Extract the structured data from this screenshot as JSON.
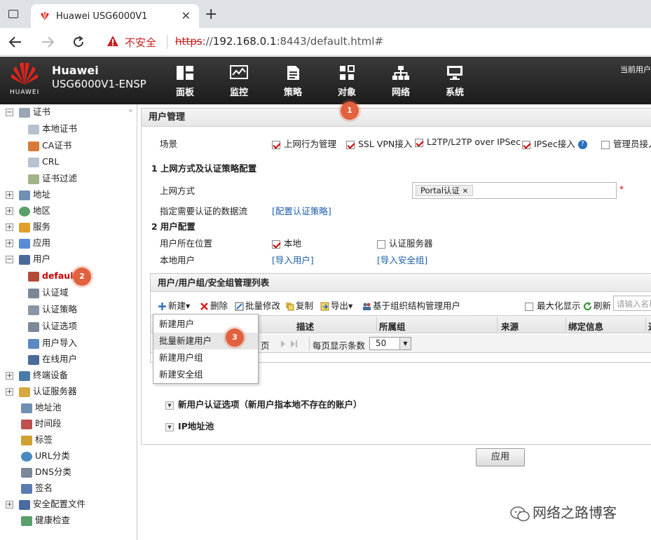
{
  "browser": {
    "tab_title": "Huawei USG6000V1",
    "tab_close": "✕",
    "new_tab": "+",
    "security_label": "不安全",
    "url_scheme": "https",
    "url_host": "192.168.0.1",
    "url_rest": ":8443/default.html#"
  },
  "header": {
    "logo_text": "HUAWEI",
    "brand_name": "Huawei",
    "product_name": "USG6000V1-ENSP",
    "current_user_label": "当前用户",
    "nav": [
      {
        "label": "面板",
        "icon": "dashboard-icon"
      },
      {
        "label": "监控",
        "icon": "monitor-icon"
      },
      {
        "label": "策略",
        "icon": "policy-icon"
      },
      {
        "label": "对象",
        "icon": "object-icon"
      },
      {
        "label": "网络",
        "icon": "network-icon"
      },
      {
        "label": "系统",
        "icon": "system-icon"
      }
    ]
  },
  "sidebar": {
    "collapse": "«",
    "items": [
      {
        "label": "证书",
        "expander": "−"
      },
      {
        "label": "本地证书"
      },
      {
        "label": "CA证书"
      },
      {
        "label": "CRL"
      },
      {
        "label": "证书过滤"
      },
      {
        "label": "地址",
        "expander": "+"
      },
      {
        "label": "地区",
        "expander": "+"
      },
      {
        "label": "服务",
        "expander": "+"
      },
      {
        "label": "应用",
        "expander": "+"
      },
      {
        "label": "用户",
        "expander": "−"
      },
      {
        "label": "default"
      },
      {
        "label": "认证域"
      },
      {
        "label": "认证策略"
      },
      {
        "label": "认证选项"
      },
      {
        "label": "用户导入"
      },
      {
        "label": "在线用户"
      },
      {
        "label": "终端设备",
        "expander": "+"
      },
      {
        "label": "认证服务器",
        "expander": "+"
      },
      {
        "label": "地址池"
      },
      {
        "label": "时间段"
      },
      {
        "label": "标签"
      },
      {
        "label": "URL分类"
      },
      {
        "label": "DNS分类"
      },
      {
        "label": "签名"
      },
      {
        "label": "安全配置文件",
        "expander": "+"
      },
      {
        "label": "健康检查"
      }
    ]
  },
  "main": {
    "title": "用户管理",
    "scene_label": "场景",
    "scenes": [
      {
        "label": "上网行为管理",
        "checked": true
      },
      {
        "label": "SSL VPN接入",
        "checked": true
      },
      {
        "label": "L2TP/L2TP over IPSec",
        "checked": true
      },
      {
        "label": "IPSec接入",
        "checked": true
      },
      {
        "label": "管理员接入",
        "checked": false
      }
    ],
    "help_glyph": "?",
    "section1": {
      "num": "1",
      "title": "上网方式及认证策略配置"
    },
    "access_label": "上网方式",
    "access_tag": "Portal认证",
    "tag_remove": "✕",
    "required_mark": "*",
    "flow_label": "指定需要认证的数据流",
    "flow_link": "[配置认证策略]",
    "section2": {
      "num": "2",
      "title": "用户配置"
    },
    "location_label": "用户所在位置",
    "location_local": {
      "label": "本地",
      "checked": true
    },
    "location_server": {
      "label": "认证服务器",
      "checked": false
    },
    "local_user_label": "本地用户",
    "import_user": "[导入用户]",
    "import_group": "[导入安全组]",
    "list": {
      "title": "用户/用户组/安全组管理列表",
      "toolbar": {
        "new": "新建",
        "delete": "删除",
        "batch_edit": "批量修改",
        "copy": "复制",
        "export": "导出",
        "org_manage": "基于组织结构管理用户",
        "maximize": "最大化显示",
        "refresh": "刷新",
        "search_placeholder": "请输入名称"
      },
      "columns": [
        "描述",
        "所属组",
        "来源",
        "绑定信息",
        "过"
      ],
      "pager_page": "页",
      "pager_size_label": "每页显示条数",
      "pager_size": "50"
    },
    "dropdown": [
      "新建用户",
      "批量新建用户",
      "新建用户组",
      "新建安全组"
    ],
    "expanders": [
      "新用户认证选项（新用户指本地不存在的账户）",
      "IP地址池"
    ],
    "apply": "应用"
  },
  "badges": [
    "1",
    "2",
    "3"
  ],
  "watermark": "网络之路博客",
  "colors": {
    "accent_red": "#c5221f",
    "badge": "#e2613e",
    "link": "#1a5ea8"
  }
}
